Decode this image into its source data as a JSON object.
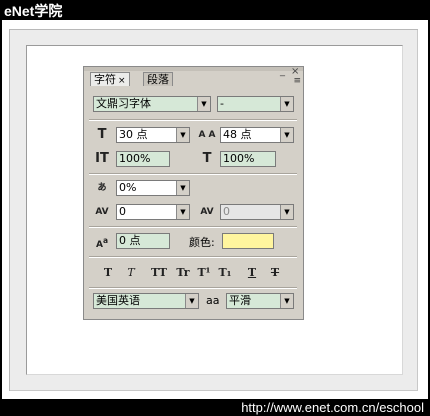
{
  "brand": "eNet学院",
  "footer_url": "http://www.enet.com.cn/eschool",
  "colors": {
    "field_bg": "#d6e8d7",
    "panel_bg": "#d4d0c8",
    "text_color_swatch": "#fff59e"
  },
  "panel": {
    "tabs": [
      {
        "label": "字符",
        "close": "×",
        "active": true
      },
      {
        "label": "段落",
        "active": false
      }
    ],
    "window_controls": {
      "minimize": "_",
      "close": "×"
    },
    "menu_icon": "≡",
    "font_family": "文鼎习字体",
    "font_style": "-",
    "font_size": "30 点",
    "leading": "48 点",
    "vertical_scale": "100%",
    "horizontal_scale": "100%",
    "tsume": "0%",
    "kerning": "0",
    "tracking": "0",
    "baseline_shift": "0 点",
    "color_label": "颜色:",
    "style_buttons": [
      "T",
      "T",
      "TT",
      "Tr",
      "T¹",
      "T₁",
      "T",
      "T"
    ],
    "language": "美国英语",
    "antialias_icon": "aa",
    "antialias": "平滑"
  }
}
